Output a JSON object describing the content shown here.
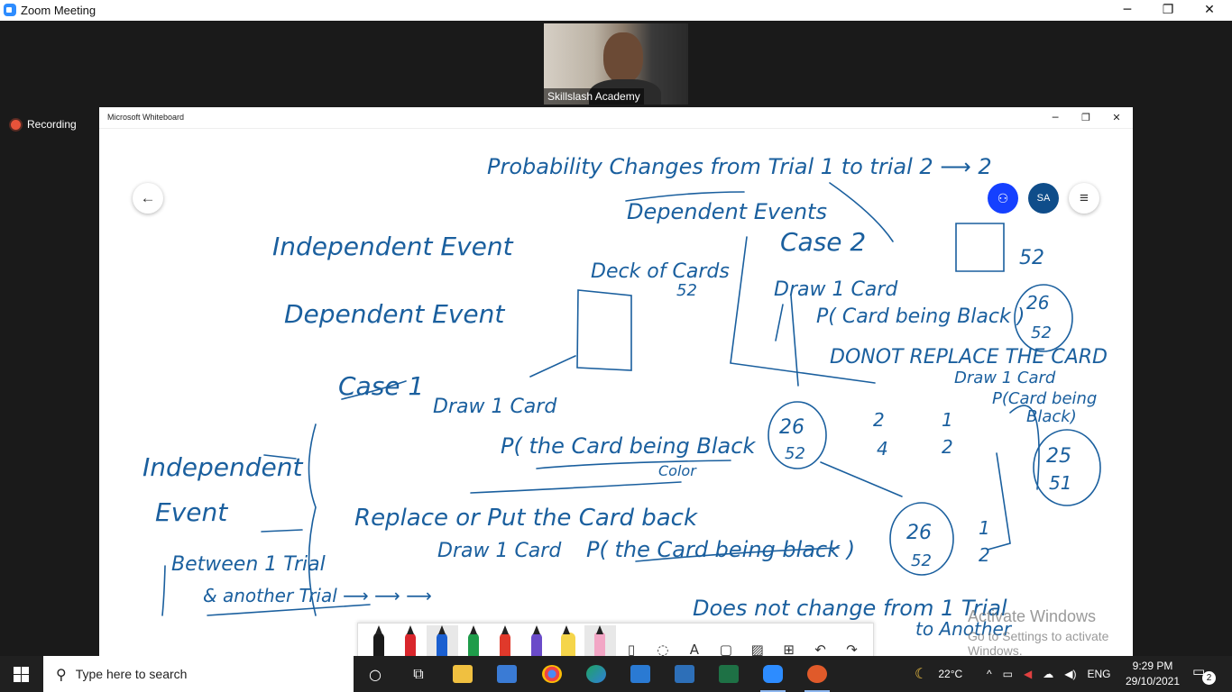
{
  "zoom": {
    "title": "Zoom Meeting",
    "participant_name": "Skillslash Academy",
    "recording_label": "Recording",
    "minimize": "─",
    "restore": "❐",
    "close": "✕"
  },
  "whiteboard": {
    "title": "Microsoft Whiteboard",
    "minimize": "─",
    "restore": "❐",
    "close": "✕",
    "back_icon": "←",
    "invite_icon": "⚇",
    "avatar_initials": "SA",
    "menu_icon": "≡",
    "ink": {
      "heading1": "Probability Changes from Trial 1 to trial 2 ⟶ 2",
      "heading2": "Dependent Events",
      "independent_event": "Independent Event",
      "dependent_event": "Dependent Event",
      "deck_of_cards": "Deck of Cards",
      "deck_count": "52",
      "case1": "Case 1",
      "draw1_a": "Draw 1 Card",
      "p_black": "P( the Card being Black",
      "color": "Color",
      "frac_26": "26",
      "frac_52": "52",
      "frac_2": "2",
      "frac_4": "4",
      "frac_1": "1",
      "frac_2b": "2",
      "replace": "Replace or Put the Card back",
      "draw1_b": "Draw 1 Card",
      "p_black2": "P( the Card being black )",
      "eq_26": "26",
      "eq_52": "52",
      "eq_1": "1",
      "eq_2": "2",
      "not_change": "Does not change from 1 Trial",
      "to_another": "to Another",
      "indep_event": "Independent",
      "event_word": "Event",
      "between": "Between 1 Trial",
      "another_trial": "& another Trial ⟶ ⟶ ⟶",
      "case2": "Case 2",
      "draw1_c": "Draw 1 Card",
      "p_black3": "P( Card being Black )",
      "c2_26": "26",
      "c2_52": "52",
      "do_not_replace": "DONOT REPLACE THE CARD",
      "draw1_d": "Draw 1 Card",
      "p_black4": "P(Card being",
      "black_word": "Black)",
      "c2_25": "25",
      "c2_51": "51",
      "box_count": "52"
    },
    "activate_windows": "Activate Windows",
    "activate_hint": "Go to Settings to activate Windows.",
    "tools": [
      "pen-black",
      "pen-red",
      "pen-blue",
      "pen-green",
      "pen-red2",
      "pen-purple",
      "highlighter-yellow",
      "eraser",
      "ruler",
      "lasso",
      "text",
      "note",
      "image",
      "insert",
      "undo",
      "redo"
    ],
    "tool_glyphs": {
      "ruler": "▯",
      "lasso": "◌",
      "text": "A",
      "note": "▢",
      "image": "▨",
      "insert": "⊞",
      "undo": "↶",
      "redo": "↷"
    },
    "pen_colors": {
      "black": "#1a1a1a",
      "red": "#d9262c",
      "blue": "#1a5fd0",
      "green": "#1f9c4a",
      "red2": "#e0392b",
      "purple": "#6a4bc9",
      "yellow": "#f5d54a",
      "eraser": "#f2a6c5"
    }
  },
  "taskbar": {
    "search_placeholder": "Type here to search",
    "search_icon": "⚲",
    "weather": "22°C",
    "language": "ENG",
    "time": "9:29 PM",
    "date": "29/10/2021",
    "notification_count": "2",
    "tray_chevron": "^",
    "volume_icon": "◀)",
    "network_icon": "▦"
  },
  "colors": {
    "ink_blue": "#1a5f9e",
    "accent_blue": "#1540ff",
    "avatar_bg": "#0f4d8a",
    "recording_red": "#e8533a"
  }
}
